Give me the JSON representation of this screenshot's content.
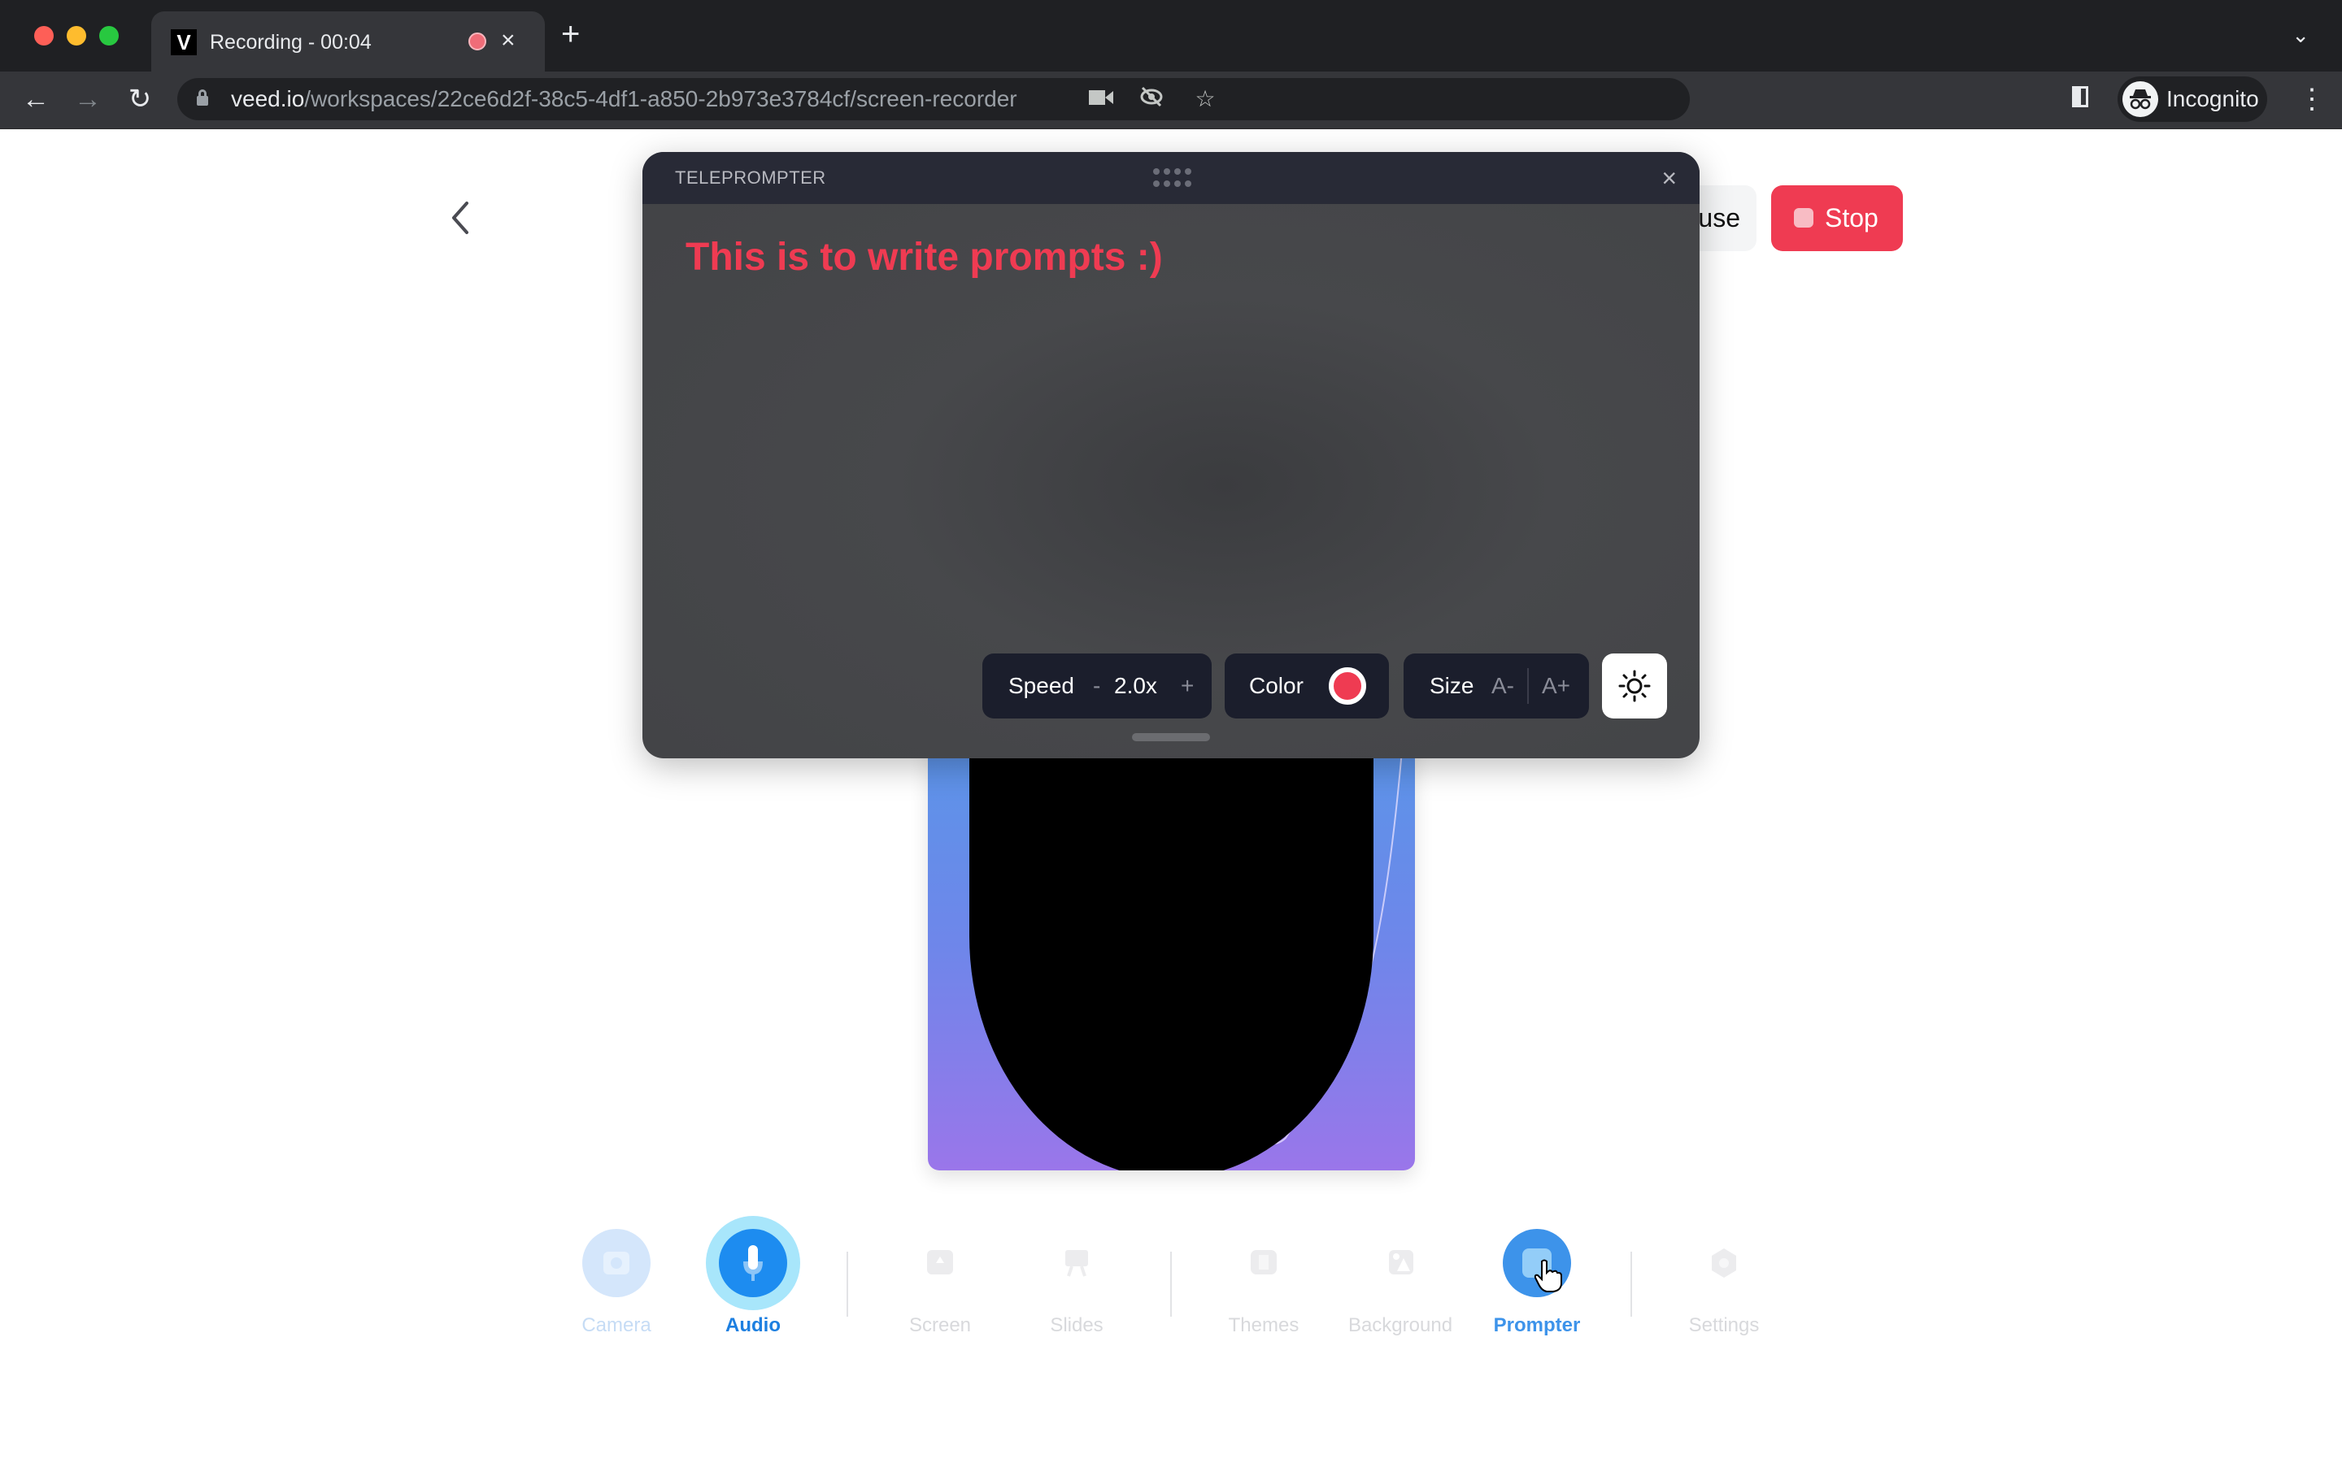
{
  "browser": {
    "tab": {
      "title": "Recording - 00:04",
      "favicon": "V",
      "close": "×",
      "recording_indicator": "recording-dot-icon"
    },
    "new_tab": "+",
    "tab_list": "⌄",
    "nav": {
      "back": "←",
      "forward": "→",
      "reload": "↻"
    },
    "url": {
      "host": "veed.io",
      "path": "/workspaces/22ce6d2f-38c5-4df1-a850-2b973e3784cf/screen-recorder"
    },
    "omnibox_icons": {
      "camera": "■",
      "eye_off": "⊘",
      "star": "☆"
    },
    "profile": {
      "label": "Incognito",
      "avatar": "🕶"
    },
    "menu": "⋮"
  },
  "page": {
    "pause_label": "Pause",
    "stop_label": "Stop"
  },
  "teleprompter": {
    "title": "TELEPROMPTER",
    "close": "×",
    "text": "This is to write prompts :)",
    "text_color": "#ef3b52",
    "speed": {
      "label": "Speed",
      "decrease": "-",
      "value": "2.0x",
      "increase": "+"
    },
    "color": {
      "label": "Color",
      "value": "#ef3b52"
    },
    "size": {
      "label": "Size",
      "decrease": "A-",
      "increase": "A+"
    }
  },
  "dock": {
    "items": [
      {
        "label": "Camera",
        "state": "disabled-active"
      },
      {
        "label": "Audio",
        "state": "active"
      },
      {
        "label": "Screen",
        "state": "disabled"
      },
      {
        "label": "Slides",
        "state": "disabled"
      },
      {
        "label": "Themes",
        "state": "disabled"
      },
      {
        "label": "Background",
        "state": "disabled"
      },
      {
        "label": "Prompter",
        "state": "active"
      },
      {
        "label": "Settings",
        "state": "disabled"
      }
    ]
  }
}
